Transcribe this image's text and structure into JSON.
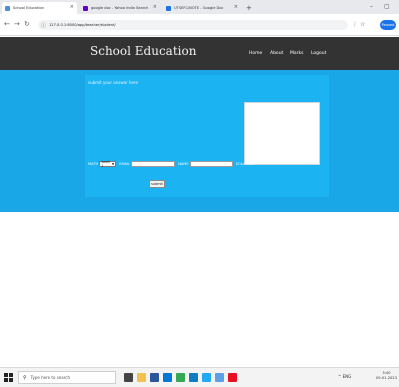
{
  "browser": {
    "tabs": [
      {
        "title": "School Education",
        "favicon_color": "#4a90d9",
        "active": true
      },
      {
        "title": "google doc - Yahoo India Search",
        "favicon_color": "#6001d2",
        "active": false
      },
      {
        "title": "UTSEFC/NOTE - Google Doc",
        "favicon_color": "#1a73e8",
        "active": false
      }
    ],
    "url": "127.0.0.1:8000/app/teacher/student/",
    "profile_label": "Paused"
  },
  "site": {
    "logo": "School Education",
    "menu": [
      "Home",
      "About",
      "Marks",
      "Logout"
    ]
  },
  "form": {
    "prompt": "submit your answer here",
    "select_label": "MATH",
    "select_value": "week 1",
    "field2_label": "EMAIL",
    "field3_label": "NAME",
    "field4_label": "SOLUTION",
    "submit_label": "submit"
  },
  "taskbar": {
    "search_placeholder": "Type here to search",
    "apps": [
      {
        "name": "task-view-icon",
        "color": "#444444"
      },
      {
        "name": "file-explorer-icon",
        "color": "#f2c14e"
      },
      {
        "name": "store-icon",
        "color": "#2b579a"
      },
      {
        "name": "mail-icon",
        "color": "#0078d4"
      },
      {
        "name": "chrome-icon",
        "color": "#34a853"
      },
      {
        "name": "edge-icon",
        "color": "#0f7dc2"
      },
      {
        "name": "vscode-icon",
        "color": "#23a9f2"
      },
      {
        "name": "files-icon",
        "color": "#5ea0e6"
      },
      {
        "name": "app-icon",
        "color": "#e81123"
      }
    ],
    "time": "3:40",
    "date": "09-01-2023",
    "tray": "^ ENG"
  },
  "colors": {
    "site_header": "#333333",
    "band": "#1aa7e8",
    "card": "#1bb3f2"
  }
}
